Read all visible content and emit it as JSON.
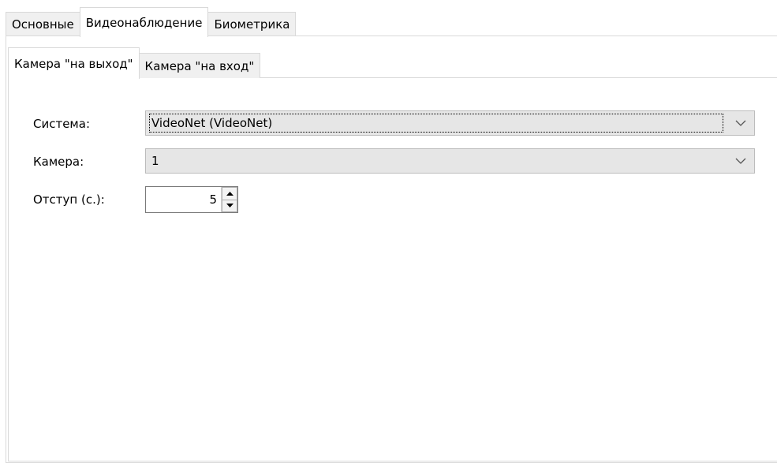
{
  "outer_tabs": [
    {
      "label": "Основные",
      "active": false
    },
    {
      "label": "Видеонаблюдение",
      "active": true
    },
    {
      "label": "Биометрика",
      "active": false
    }
  ],
  "inner_tabs": [
    {
      "label": "Камера \"на выход\"",
      "active": true
    },
    {
      "label": "Камера \"на вход\"",
      "active": false
    }
  ],
  "form": {
    "system": {
      "label": "Система:",
      "value": "VideoNet (VideoNet)"
    },
    "camera": {
      "label": "Камера:",
      "value": "1"
    },
    "offset": {
      "label": "Отступ (с.):",
      "value": "5"
    }
  },
  "icons": {
    "dropdown": "chevron-down-icon",
    "spin_up": "arrow-up-icon",
    "spin_down": "arrow-down-icon"
  },
  "colors": {
    "combo_bg": "#e6e6e6",
    "border": "#d9d9d9",
    "inactive_tab_bg": "#f0f0f0"
  }
}
